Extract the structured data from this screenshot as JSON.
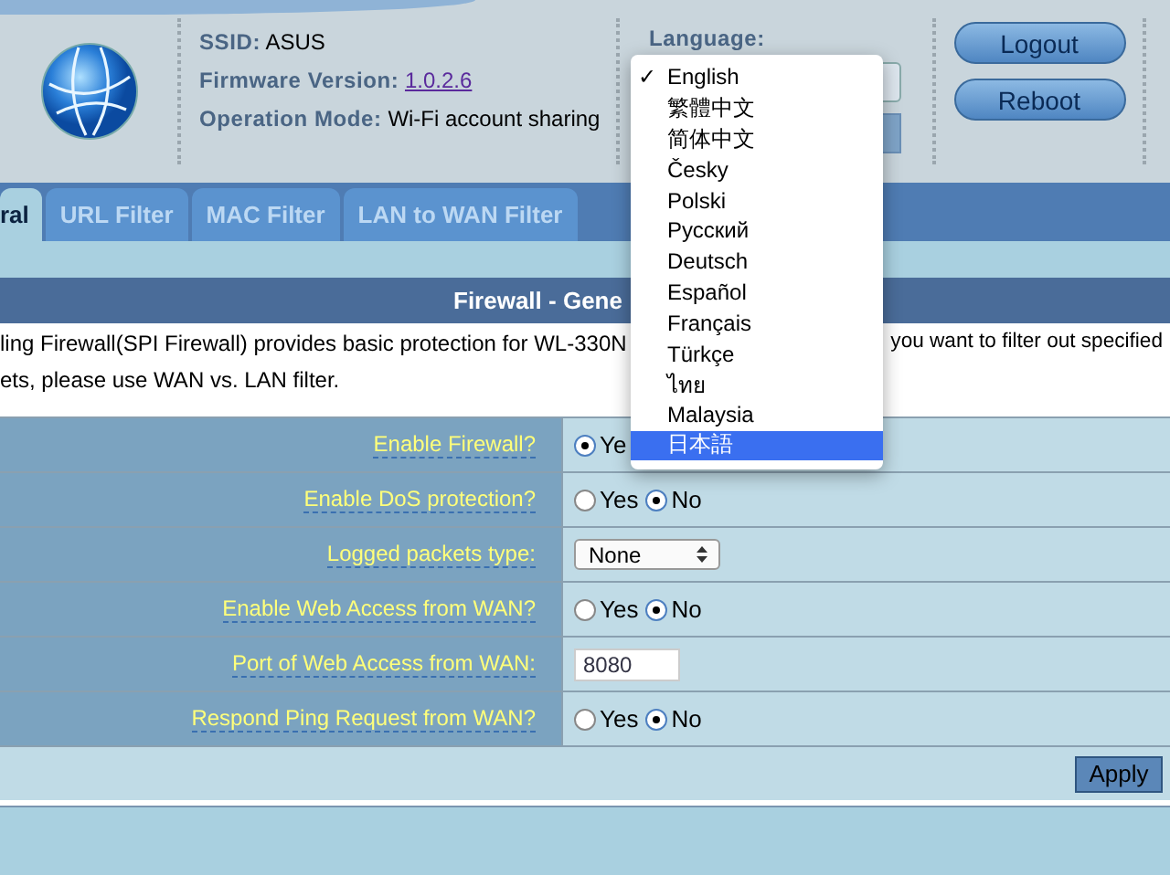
{
  "header": {
    "ssid_label": "SSID:",
    "ssid": "ASUS",
    "firmware_label": "Firmware Version:",
    "firmware": "1.0.2.6",
    "mode_label": "Operation Mode:",
    "mode": "Wi-Fi account sharing",
    "language_label": "Language:",
    "buttons": [
      "Logout",
      "Reboot"
    ]
  },
  "check_mark": "✓",
  "language_menu": [
    {
      "label": "English",
      "selected": false,
      "checked": true
    },
    {
      "label": "繁體中文",
      "selected": false,
      "checked": false
    },
    {
      "label": "简体中文",
      "selected": false,
      "checked": false
    },
    {
      "label": "Česky",
      "selected": false,
      "checked": false
    },
    {
      "label": "Polski",
      "selected": false,
      "checked": false
    },
    {
      "label": "Русский",
      "selected": false,
      "checked": false
    },
    {
      "label": "Deutsch",
      "selected": false,
      "checked": false
    },
    {
      "label": "Español",
      "selected": false,
      "checked": false
    },
    {
      "label": "Français",
      "selected": false,
      "checked": false
    },
    {
      "label": "Türkçe",
      "selected": false,
      "checked": false
    },
    {
      "label": "ไทย",
      "selected": false,
      "checked": false
    },
    {
      "label": "Malaysia",
      "selected": false,
      "checked": false
    },
    {
      "label": "日本語",
      "selected": true,
      "checked": false
    }
  ],
  "tabs": [
    {
      "label": "ral",
      "selected": true
    },
    {
      "label": "URL Filter",
      "selected": false
    },
    {
      "label": "MAC Filter",
      "selected": false
    },
    {
      "label": "LAN to WAN Filter",
      "selected": false
    }
  ],
  "section_title": "Firewall - Gene",
  "description": [
    "ling Firewall(SPI Firewall) provides basic protection for WL-330N",
    "you want to filter out specified",
    "ets, please use WAN vs. LAN filter."
  ],
  "settings": [
    {
      "label": "Enable Firewall?",
      "kind": "radio",
      "options": [
        {
          "label": "Ye",
          "selected": true
        }
      ]
    },
    {
      "label": "Enable DoS protection?",
      "kind": "radio",
      "options": [
        {
          "label": "Yes",
          "selected": false
        },
        {
          "label": "No",
          "selected": true
        }
      ]
    },
    {
      "label": "Logged packets type:",
      "kind": "select",
      "value": "None"
    },
    {
      "label": "Enable Web Access from WAN?",
      "kind": "radio",
      "options": [
        {
          "label": "Yes",
          "selected": false
        },
        {
          "label": "No",
          "selected": true
        }
      ]
    },
    {
      "label": "Port of Web Access from WAN:",
      "kind": "input",
      "value": "8080"
    },
    {
      "label": "Respond Ping Request from WAN?",
      "kind": "radio",
      "options": [
        {
          "label": "Yes",
          "selected": false
        },
        {
          "label": "No",
          "selected": true
        }
      ]
    }
  ],
  "apply_button": "Apply"
}
